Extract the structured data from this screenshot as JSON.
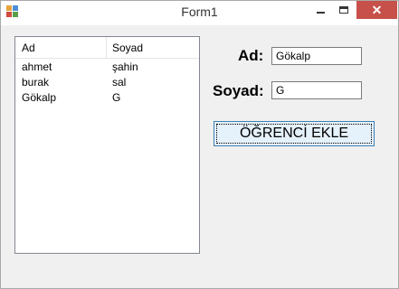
{
  "window": {
    "title": "Form1",
    "controls": {
      "minimize_icon": "minimize-icon",
      "maximize_icon": "maximize-icon",
      "close_icon": "close-icon",
      "close_color": "#c7504a"
    }
  },
  "listview": {
    "columns": [
      "Ad",
      "Soyad"
    ],
    "rows": [
      [
        "ahmet",
        "şahin"
      ],
      [
        "burak",
        "sal"
      ],
      [
        "Gökalp",
        "G"
      ]
    ]
  },
  "form": {
    "ad_label": "Ad:",
    "ad_value": "Gökalp",
    "soyad_label": "Soyad:",
    "soyad_value": "G",
    "button_label": "ÖĞRENCİ EKLE"
  }
}
